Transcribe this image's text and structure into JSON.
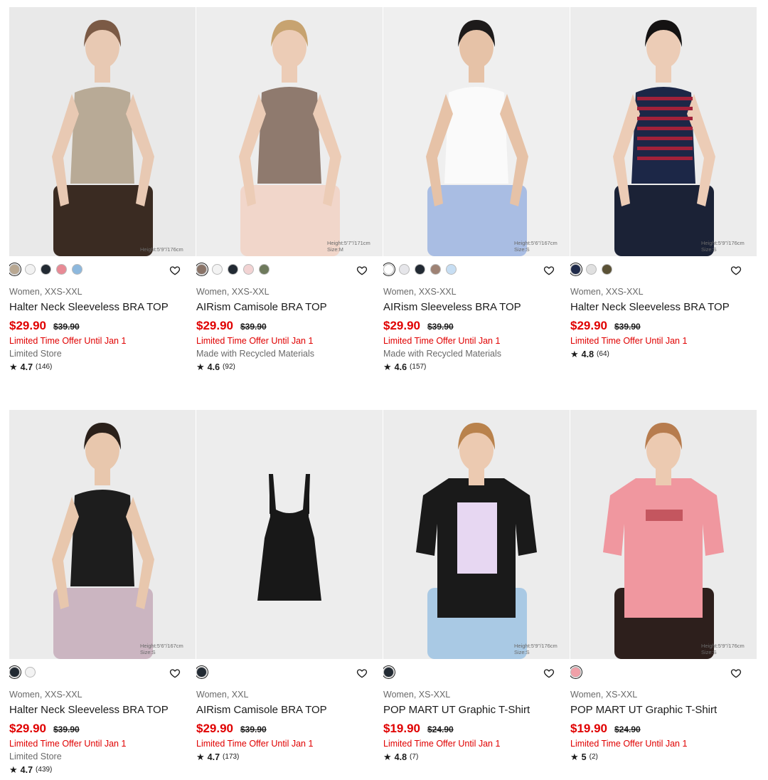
{
  "products": [
    {
      "category": "Women, XXS-XXL",
      "name": "Halter Neck Sleeveless BRA TOP",
      "price": "$29.90",
      "was": "$39.90",
      "offer": "Limited Time Offer Until Jan 1",
      "extra": "Limited Store",
      "rating": "4.7",
      "reviews": "(146)",
      "model_note": "Height:5'9\"/176cm",
      "model_size": "",
      "swatches": [
        "#b9a892",
        "#f2f2f2",
        "#222a33",
        "#e88a95",
        "#8db8dd"
      ],
      "photo": {
        "bg": "#e9e9e9",
        "top": "#b8aa96",
        "bottom": "#3a2b22",
        "skin": "#e8c9b3",
        "hair": "#7b5a45"
      }
    },
    {
      "category": "Women, XXS-XXL",
      "name": "AIRism Camisole BRA TOP",
      "price": "$29.90",
      "was": "$39.90",
      "offer": "Limited Time Offer Until Jan 1",
      "extra": "Made with Recycled Materials",
      "rating": "4.6",
      "reviews": "(92)",
      "model_note": "Height:5'7\"/171cm",
      "model_size": "Size:M",
      "swatches": [
        "#8a7468",
        "#f3f3f3",
        "#222a33",
        "#f2d3d3",
        "#6e7a5c"
      ],
      "photo": {
        "bg": "#ededed",
        "top": "#8f7a6e",
        "bottom": "#f1d6ca",
        "skin": "#ecccb6",
        "hair": "#c7a370"
      }
    },
    {
      "category": "Women, XXS-XXL",
      "name": "AIRism Sleeveless BRA TOP",
      "price": "$29.90",
      "was": "$39.90",
      "offer": "Limited Time Offer Until Jan 1",
      "extra": "Made with Recycled Materials",
      "rating": "4.6",
      "reviews": "(157)",
      "model_note": "Height:5'6\"/167cm",
      "model_size": "Size:S",
      "swatches": [
        "#ffffff",
        "#e6e6ea",
        "#222a33",
        "#9e8274",
        "#c7def3"
      ],
      "photo": {
        "bg": "#efefef",
        "top": "#fafafa",
        "bottom": "#a9bde3",
        "skin": "#e6c2a7",
        "hair": "#1d1a1a"
      }
    },
    {
      "category": "Women, XXS-XXL",
      "name": "Halter Neck Sleeveless BRA TOP",
      "price": "$29.90",
      "was": "$39.90",
      "offer": "Limited Time Offer Until Jan 1",
      "extra": "",
      "rating": "4.8",
      "reviews": "(64)",
      "model_note": "Height:5'9\"/176cm",
      "model_size": "Size:S",
      "swatches": [
        "#1f2a4a",
        "#e0e0e0",
        "#5b5236"
      ],
      "photo": {
        "bg": "#ececec",
        "top": "#1c2747",
        "bottom": "#1b2236",
        "skin": "#ecccb6",
        "hair": "#141212"
      }
    },
    {
      "category": "Women, XXS-XXL",
      "name": "Halter Neck Sleeveless BRA TOP",
      "price": "$29.90",
      "was": "$39.90",
      "offer": "Limited Time Offer Until Jan 1",
      "extra": "Limited Store",
      "rating": "4.7",
      "reviews": "(439)",
      "model_note": "Height:5'6\"/167cm",
      "model_size": "Size:S",
      "swatches": [
        "#222a33",
        "#f3f3f3"
      ],
      "photo": {
        "bg": "#ebebeb",
        "top": "#1d1d1d",
        "bottom": "#cbb5c1",
        "skin": "#e8c7ad",
        "hair": "#2a201a"
      }
    },
    {
      "category": "Women, XXL",
      "name": "AIRism Camisole BRA TOP",
      "price": "$29.90",
      "was": "$39.90",
      "offer": "Limited Time Offer Until Jan 1",
      "extra": "",
      "rating": "4.7",
      "reviews": "(173)",
      "model_note": "",
      "model_size": "",
      "swatches": [
        "#222a33"
      ],
      "photo": {
        "bg": "#ededed",
        "top": "#181818",
        "bottom": "",
        "skin": "",
        "hair": ""
      }
    },
    {
      "category": "Women, XS-XXL",
      "name": "POP MART UT Graphic T-Shirt",
      "price": "$19.90",
      "was": "$24.90",
      "offer": "Limited Time Offer Until Jan 1",
      "extra": "",
      "rating": "4.8",
      "reviews": "(7)",
      "model_note": "Height:5'9\"/176cm",
      "model_size": "Size:S",
      "swatches": [
        "#222a33"
      ],
      "photo": {
        "bg": "#ececec",
        "top": "#1a1a1a",
        "bottom": "#a9c9e4",
        "skin": "#eccab1",
        "hair": "#b9824c"
      }
    },
    {
      "category": "Women, XS-XXL",
      "name": "POP MART UT Graphic T-Shirt",
      "price": "$19.90",
      "was": "$24.90",
      "offer": "Limited Time Offer Until Jan 1",
      "extra": "",
      "rating": "5",
      "reviews": "(2)",
      "model_note": "Height:5'9\"/176cm",
      "model_size": "Size:S",
      "swatches": [
        "#f0a0a8"
      ],
      "photo": {
        "bg": "#ebebeb",
        "top": "#f0979f",
        "bottom": "#2d1f1c",
        "skin": "#eccab1",
        "hair": "#b77c4e"
      }
    }
  ]
}
